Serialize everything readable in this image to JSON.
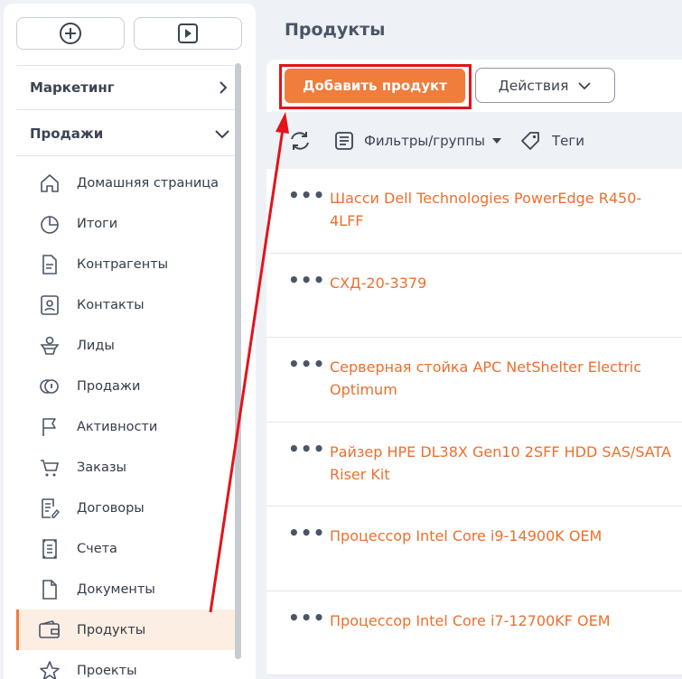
{
  "sidebar": {
    "sections": [
      {
        "label": "Маркетинг",
        "expanded": false
      },
      {
        "label": "Продажи",
        "expanded": true
      }
    ],
    "items": [
      {
        "label": "Домашняя страница",
        "icon": "home-icon"
      },
      {
        "label": "Итоги",
        "icon": "pie-chart-icon"
      },
      {
        "label": "Контрагенты",
        "icon": "document-icon"
      },
      {
        "label": "Контакты",
        "icon": "contact-card-icon"
      },
      {
        "label": "Лиды",
        "icon": "lead-funnel-icon"
      },
      {
        "label": "Продажи",
        "icon": "coins-icon"
      },
      {
        "label": "Активности",
        "icon": "flag-icon"
      },
      {
        "label": "Заказы",
        "icon": "cart-icon"
      },
      {
        "label": "Договоры",
        "icon": "contract-icon"
      },
      {
        "label": "Счета",
        "icon": "invoice-icon"
      },
      {
        "label": "Документы",
        "icon": "file-icon"
      },
      {
        "label": "Продукты",
        "icon": "wallet-icon",
        "active": true
      },
      {
        "label": "Проекты",
        "icon": "star-icon"
      }
    ]
  },
  "main": {
    "title": "Продукты",
    "toolbar": {
      "add_label": "Добавить продукт",
      "actions_label": "Действия"
    },
    "filters": {
      "filters_label": "Фильтры/группы",
      "tags_label": "Теги"
    },
    "products": [
      "Шасси Dell Technologies PowerEdge R450-4LFF",
      "СХД-20-3379",
      "Серверная стойка APC NetShelter Electric Optimum",
      "Райзер HPE DL38X Gen10 2SFF HDD SAS/SATA Riser Kit",
      "Процессор Intel Core i9-14900K OEM",
      "Процессор Intel Core i7-12700KF OEM"
    ]
  },
  "colors": {
    "accent": "#f07d3b",
    "link": "#ec6f2e",
    "annotation": "#e3131b"
  }
}
